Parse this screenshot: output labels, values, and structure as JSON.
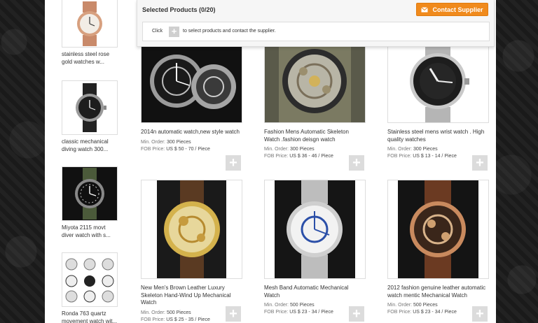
{
  "selected_panel": {
    "title": "Selected Products (0/20)",
    "contact_label": "Contact Supplier",
    "click_label": "Click",
    "hint": "to select products and contact the supplier."
  },
  "left_items": [
    {
      "name": "stainless steel rose gold watches w..."
    },
    {
      "name": "classic mechanical diving watch 300..."
    },
    {
      "name": "Miyota 2115 movt diver watch with s..."
    },
    {
      "name": "Ronda 763 quartz movement watch wit..."
    }
  ],
  "products": [
    {
      "title": "2014n automatic watch,new style watch",
      "min_order_label": "Min. Order:",
      "min_order": "300 Pieces",
      "fob_label": "FOB Price:",
      "fob": "US $ 50 - 70 / Piece"
    },
    {
      "title": "Fashion Mens Automatic Skeleton Watch .fashion deisgn watch",
      "min_order_label": "Min. Order:",
      "min_order": "300 Pieces",
      "fob_label": "FOB Price:",
      "fob": "US $ 36 - 46 / Piece"
    },
    {
      "title": "Stainless steel mens wrist watch . High quality watches",
      "min_order_label": "Min. Order:",
      "min_order": "300 Pieces",
      "fob_label": "FOB Price:",
      "fob": "US $ 13 - 14 / Piece"
    },
    {
      "title": "New Men's Brown Leather Luxury Skeleton Hand-Wind Up Mechanical Watch",
      "min_order_label": "Min. Order:",
      "min_order": "500 Pieces",
      "fob_label": "FOB Price:",
      "fob": "US $ 25 - 35 / Piece"
    },
    {
      "title": "Mesh Band Automatic Mechanical Watch",
      "min_order_label": "Min. Order:",
      "min_order": "500 Pieces",
      "fob_label": "FOB Price:",
      "fob": "US $ 23 - 34 / Piece"
    },
    {
      "title": "2012 fashion genuine leather automatic watch mentic Mechanical Watch",
      "min_order_label": "Min. Order:",
      "min_order": "500 Pieces",
      "fob_label": "FOB Price:",
      "fob": "US $ 23 - 34 / Piece"
    }
  ],
  "colors": {
    "accent": "#f08a1c",
    "add_button": "#dcdcdc"
  },
  "icons": {
    "add": "plus-icon",
    "contact": "envelope-icon"
  }
}
